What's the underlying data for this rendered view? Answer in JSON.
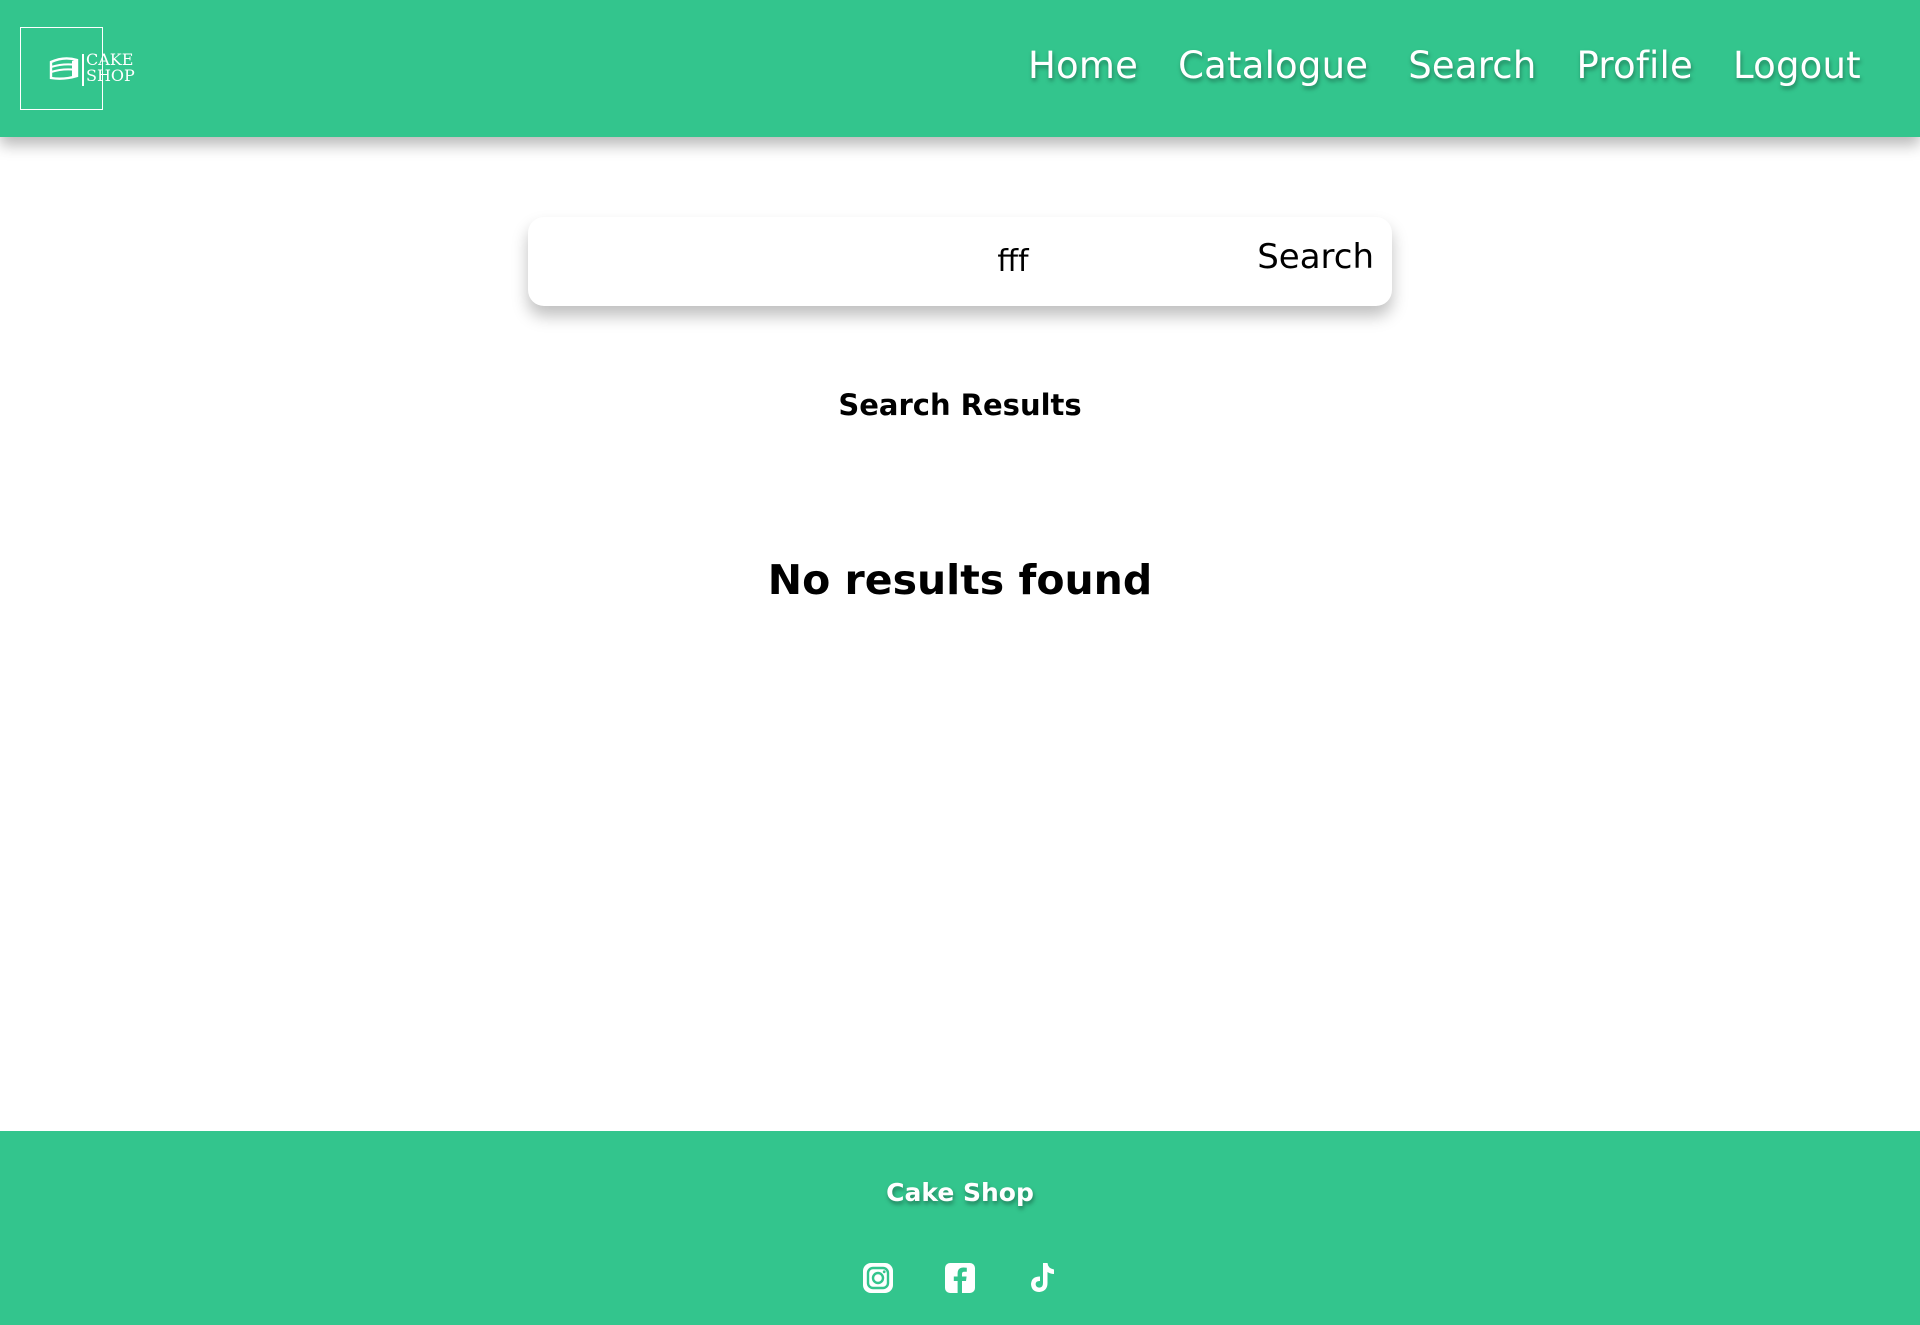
{
  "brand": {
    "logo_line1": "CAKE",
    "logo_line2": "SHOP"
  },
  "nav": {
    "items": [
      {
        "label": "Home"
      },
      {
        "label": "Catalogue"
      },
      {
        "label": "Search"
      },
      {
        "label": "Profile"
      },
      {
        "label": "Logout"
      }
    ]
  },
  "search": {
    "value": "fff",
    "button_label": "Search"
  },
  "results": {
    "title": "Search Results",
    "empty_message": "No results found"
  },
  "footer": {
    "title": "Cake Shop",
    "socials": [
      {
        "icon": "instagram-icon"
      },
      {
        "icon": "facebook-icon"
      },
      {
        "icon": "tiktok-icon"
      }
    ]
  },
  "colors": {
    "brand_green": "#33c58d",
    "text": "#000000",
    "white": "#ffffff"
  }
}
